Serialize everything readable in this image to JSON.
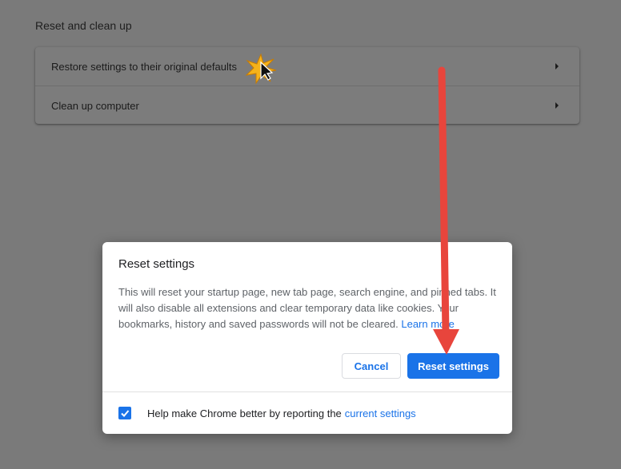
{
  "section": {
    "title": "Reset and clean up",
    "items": [
      {
        "label": "Restore settings to their original defaults"
      },
      {
        "label": "Clean up computer"
      }
    ]
  },
  "dialog": {
    "title": "Reset settings",
    "body_line1": "This will reset your startup page, new tab page, search engine, and pinned tabs. It",
    "body_line2": "will also disable all extensions and clear temporary data like cookies. Your",
    "body_line3": "bookmarks, history and saved passwords will not be cleared.",
    "learn_more": "Learn more",
    "cancel_label": "Cancel",
    "reset_label": "Reset settings",
    "footer_text": "Help make Chrome better by reporting the",
    "footer_link": "current settings",
    "checkbox_checked": true
  },
  "icons": {
    "row_arrow": "triangle-right-icon",
    "checkbox_check": "check-icon",
    "cursor": "mouse-pointer-icon"
  },
  "colors": {
    "accent": "#1a73e8",
    "annotation_arrow": "#e8453c",
    "overlay_bg": "#7a7a7a"
  }
}
